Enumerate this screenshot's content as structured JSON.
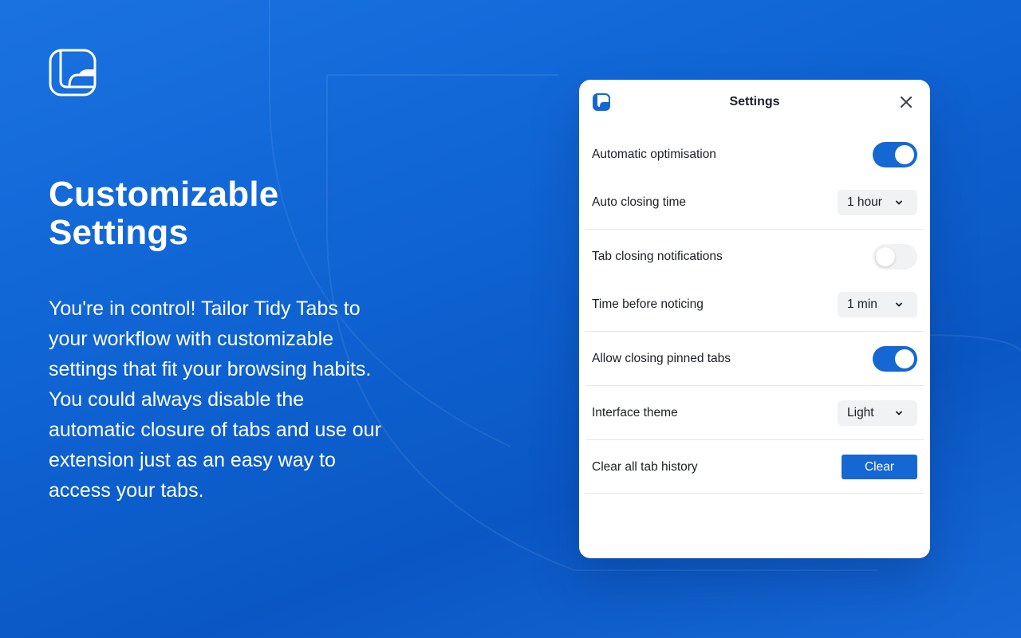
{
  "hero": {
    "title_line1": "Customizable",
    "title_line2": "Settings",
    "description": "You're in control! Tailor Tidy Tabs to your workflow with customizable settings that fit your browsing habits. You could always disable the automatic closure of tabs and use our extension just as an easy way to access your tabs."
  },
  "settings": {
    "title": "Settings",
    "automatic_optimisation": {
      "label": "Automatic optimisation",
      "enabled": true
    },
    "auto_closing_time": {
      "label": "Auto closing time",
      "value": "1 hour"
    },
    "tab_closing_notifications": {
      "label": "Tab closing notifications",
      "enabled": false
    },
    "time_before_noticing": {
      "label": "Time before noticing",
      "value": "1 min"
    },
    "allow_closing_pinned_tabs": {
      "label": "Allow closing pinned tabs",
      "enabled": true
    },
    "interface_theme": {
      "label": "Interface theme",
      "value": "Light"
    },
    "clear_history": {
      "label": "Clear all tab history",
      "button_label": "Clear"
    }
  },
  "colors": {
    "brand_blue": "#1567d3",
    "background_blue": "#0f63d3"
  },
  "icons": [
    "app-logo-icon",
    "close-icon",
    "chevron-down-icon"
  ]
}
